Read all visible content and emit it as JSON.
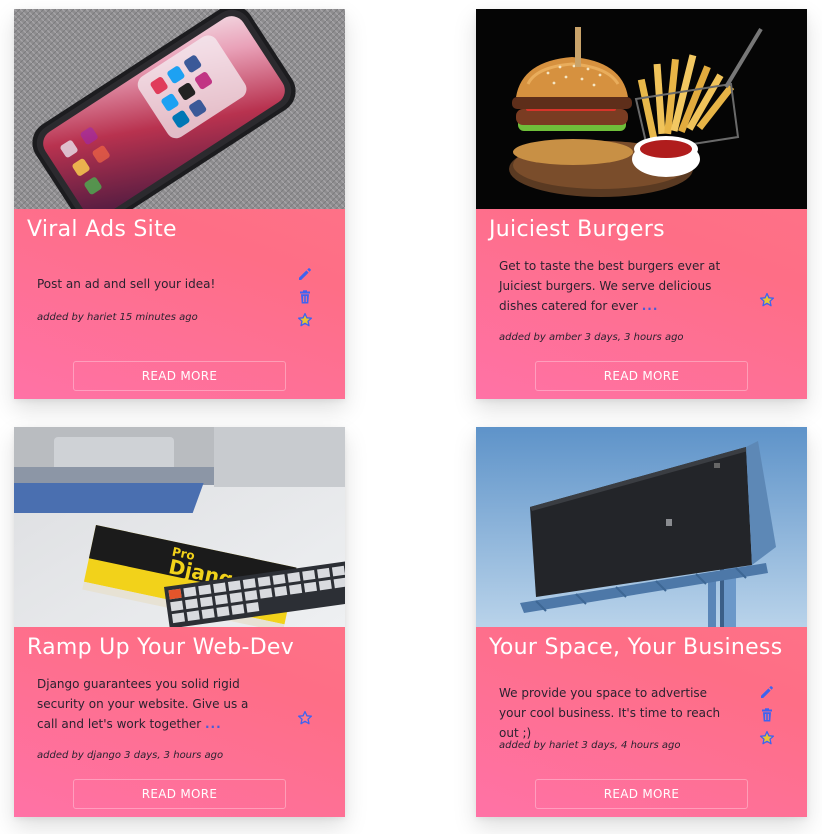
{
  "cards": [
    {
      "title": "Viral Ads Site",
      "description": "Post an ad and sell your idea!",
      "more": "",
      "meta": "added by hariet 15 minutes ago",
      "button": "READ MORE",
      "image": "phone-with-social-media-apps",
      "actions": [
        "edit-icon",
        "trash-icon",
        "star-icon"
      ]
    },
    {
      "title": "Juiciest Burgers",
      "description": "Get to taste the best burgers ever at Juiciest burgers. We serve delicious dishes catered for ever",
      "more": "...",
      "meta": "added by amber 3 days, 3 hours ago",
      "button": "READ MORE",
      "image": "burger-and-fries",
      "actions": [
        "star-icon"
      ]
    },
    {
      "title": "Ramp Up Your Web-Dev",
      "description": "Django guarantees you solid rigid security on your website. Give us a call and let's work together",
      "more": "...",
      "meta": "added by django 3 days, 3 hours ago",
      "button": "READ MORE",
      "image": "pro-django-book-on-desk",
      "actions": [
        "star-icon"
      ]
    },
    {
      "title": "Your Space, Your Business",
      "description": "We provide you space to advertise your cool business. It's time to reach out ;)",
      "more": "",
      "meta": "added by hariet 3 days, 4 hours ago",
      "button": "READ MORE",
      "image": "blank-billboard-sky",
      "actions": [
        "edit-icon",
        "trash-icon",
        "star-icon"
      ]
    }
  ],
  "book": {
    "line1": "Pro",
    "line2": "Django"
  },
  "colors": {
    "card_start": "#ff7a8a",
    "card_end": "#ff72a6",
    "icon_blue": "#3e63f0",
    "star_fill": "#e8c530"
  }
}
